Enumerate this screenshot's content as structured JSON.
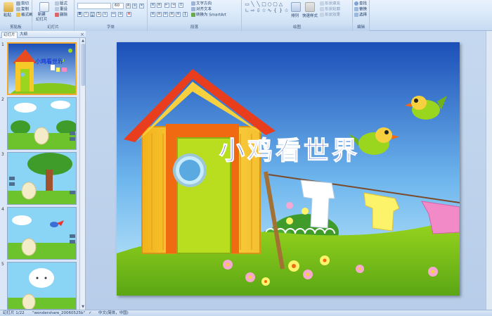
{
  "ribbon": {
    "clipboard": {
      "paste": "粘贴",
      "cut": "剪切",
      "copy": "复制",
      "format_painter": "格式刷",
      "label": "剪贴板"
    },
    "slides": {
      "new_slide": "新建\n幻灯片",
      "layout": "版式",
      "reset": "重设",
      "delete": "删除",
      "label": "幻灯片"
    },
    "font": {
      "font_name": "",
      "font_size": "60",
      "label": "字体"
    },
    "paragraph": {
      "text_direction": "文字方向",
      "align_text": "对齐文本",
      "smartart": "转换为 SmartArt",
      "label": "段落"
    },
    "drawing": {
      "arrange": "排列",
      "quick_styles": "快速样式",
      "shape_fill": "形状填充",
      "shape_outline": "形状轮廓",
      "shape_effects": "形状效果",
      "label": "绘图"
    },
    "editing": {
      "find": "查找",
      "replace": "替换",
      "select": "选择",
      "label": "编辑"
    }
  },
  "pane": {
    "tab_slides": "幻灯片",
    "tab_outline": "大纲",
    "close": "×",
    "thumbs": [
      {
        "num": "1"
      },
      {
        "num": "2"
      },
      {
        "num": "3"
      },
      {
        "num": "4"
      },
      {
        "num": "5"
      }
    ],
    "slide1_title": "小鸡看世界"
  },
  "slide": {
    "title": "小鸡看世界",
    "colors": {
      "sky_top": "#1c4fb8",
      "sky_bottom": "#c8ecfb",
      "grass": "#86c81c",
      "title": "#1b3fd6"
    }
  },
  "status": {
    "slide_info": "幻灯片 1/22",
    "theme": "\"wondershare_20060525b\"",
    "language": "中文(简体，中国)"
  }
}
